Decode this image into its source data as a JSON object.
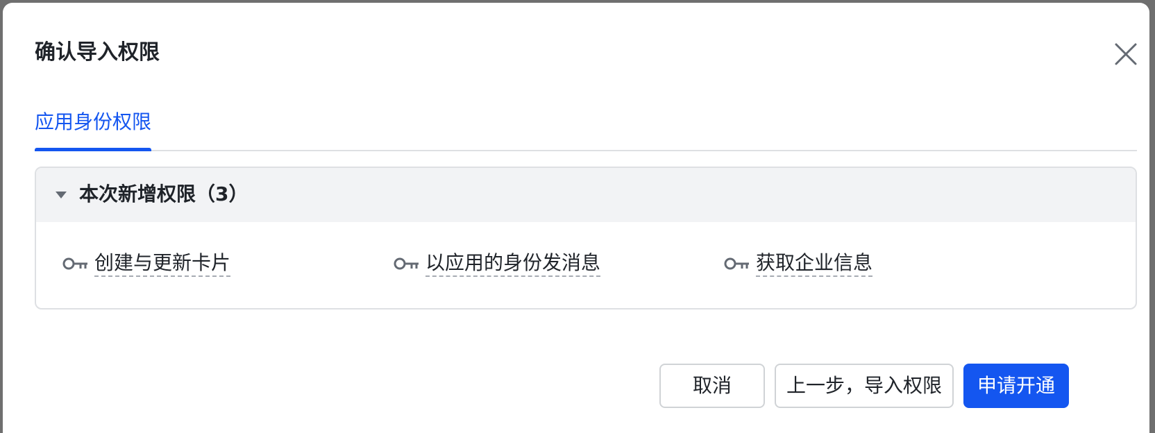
{
  "dialog": {
    "title": "确认导入权限",
    "close_icon": "close-icon"
  },
  "tabs": [
    {
      "label": "应用身份权限",
      "active": true
    }
  ],
  "panel": {
    "title": "本次新增权限（3）",
    "expanded": true,
    "permissions": [
      {
        "label": "创建与更新卡片",
        "icon": "key-icon"
      },
      {
        "label": "以应用的身份发消息",
        "icon": "key-icon"
      },
      {
        "label": "获取企业信息",
        "icon": "key-icon"
      }
    ]
  },
  "footer": {
    "cancel_label": "取消",
    "back_label": "上一步，导入权限",
    "submit_label": "申请开通"
  },
  "colors": {
    "accent": "#1456f0",
    "header_bg": "#f2f3f5",
    "text": "#1f2329",
    "border": "#dee0e3"
  }
}
